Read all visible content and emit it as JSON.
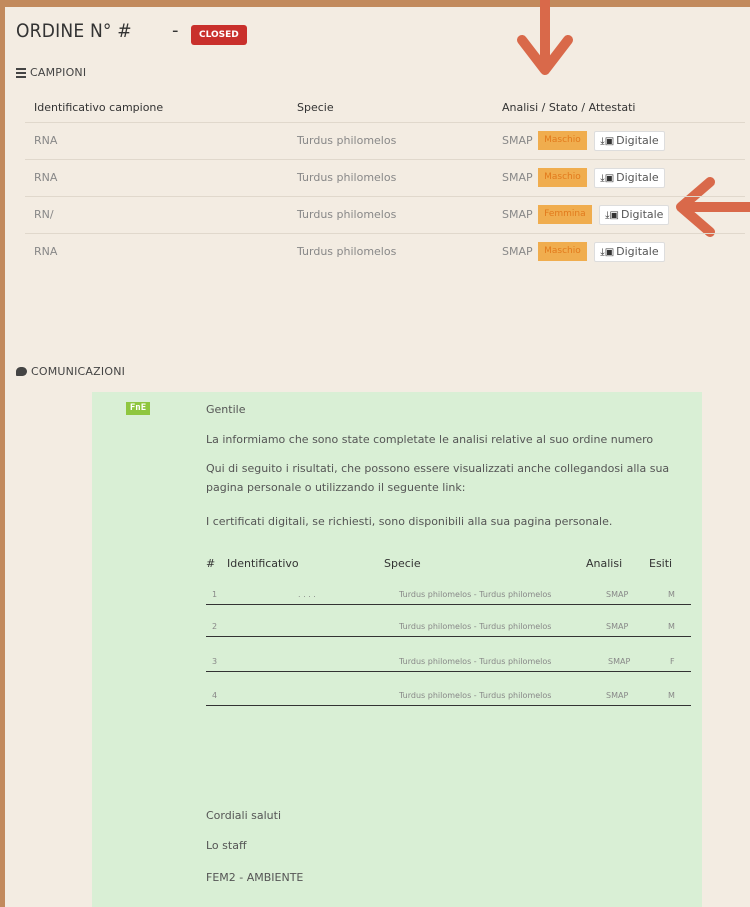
{
  "order": {
    "title": "ORDINE N° #",
    "dash": "-",
    "status": "CLOSED",
    "status_color": "#c9302c"
  },
  "campioni": {
    "section_title": "CAMPIONI",
    "headers": [
      "Identificativo campione",
      "Specie",
      "Analisi / Stato / Attestati"
    ],
    "rows": [
      {
        "id": "RNA",
        "specie": "Turdus philomelos",
        "analisi": "SMAP",
        "stato": "Maschio",
        "attestato": "Digitale"
      },
      {
        "id": "RNA",
        "specie": "Turdus philomelos",
        "analisi": "SMAP",
        "stato": "Maschio",
        "attestato": "Digitale"
      },
      {
        "id": "RN/",
        "specie": "Turdus philomelos",
        "analisi": "SMAP",
        "stato": "Femmina",
        "attestato": "Digitale"
      },
      {
        "id": "RNA",
        "specie": "Turdus philomelos",
        "analisi": "SMAP",
        "stato": "Maschio",
        "attestato": "Digitale"
      }
    ]
  },
  "comunicazioni": {
    "section_title": "COMUNICAZIONI",
    "logo_text": "FnE",
    "greeting": "Gentile",
    "line1": "La informiamo che sono state completate le analisi relative al suo ordine numero",
    "line2": "Qui di seguito i risultati, che possono essere visualizzati anche collegandosi alla sua pagina personale o utilizzando il seguente link:",
    "line3": "I certificati digitali, se richiesti, sono disponibili alla sua pagina personale.",
    "results_headers": [
      "#",
      "Identificativo",
      "Specie",
      "Analisi",
      "Esiti"
    ],
    "results": [
      {
        "n": "1",
        "id": ". . . .",
        "specie": "Turdus philomelos - Turdus philomelos",
        "analisi": "SMAP",
        "esito": "M"
      },
      {
        "n": "2",
        "id": "",
        "specie": "Turdus philomelos - Turdus philomelos",
        "analisi": "SMAP",
        "esito": "M"
      },
      {
        "n": "3",
        "id": "",
        "specie": "Turdus philomelos - Turdus philomelos",
        "analisi": "SMAP",
        "esito": "F"
      },
      {
        "n": "4",
        "id": "",
        "specie": "Turdus philomelos - Turdus philomelos",
        "analisi": "SMAP",
        "esito": "M"
      }
    ],
    "closing1": "Cordiali saluti",
    "closing2": "Lo staff",
    "closing3": "FEM2 - AMBIENTE"
  },
  "colors": {
    "accent_arrow": "#d9694a",
    "tag_orange": "#f0ad4e",
    "mail_bg": "#d9efd5"
  }
}
